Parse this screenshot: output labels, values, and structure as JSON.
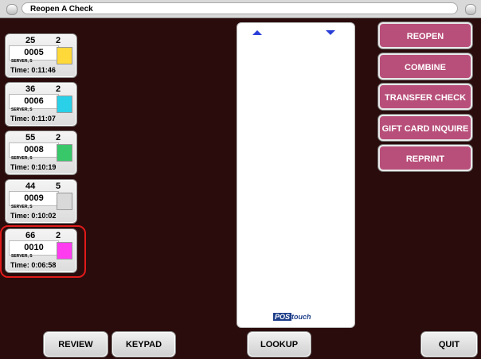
{
  "window": {
    "title": "Reopen A Check"
  },
  "checks": [
    {
      "table": "25",
      "guests": "2",
      "number": "0005",
      "server": "SERVER, S",
      "time": "Time:  0:11:46",
      "color": "#ffd83a"
    },
    {
      "table": "36",
      "guests": "2",
      "number": "0006",
      "server": "SERVER, S",
      "time": "Time:  0:11:07",
      "color": "#2ad0e8"
    },
    {
      "table": "55",
      "guests": "2",
      "number": "0008",
      "server": "SERVER, S",
      "time": "Time:  0:10:19",
      "color": "#38c86a"
    },
    {
      "table": "44",
      "guests": "5",
      "number": "0009",
      "server": "SERVER, S",
      "time": "Time:  0:10:02",
      "color": "#d9d9d9"
    },
    {
      "table": "66",
      "guests": "2",
      "number": "0010",
      "server": "SERVER, S",
      "time": "Time:  0:06:58",
      "color": "#ff3cf0"
    }
  ],
  "selected_check_index": 4,
  "panel": {
    "logo_pos": "POS",
    "logo_touch": "touch"
  },
  "actions": [
    "REOPEN",
    "COMBINE",
    "TRANSFER CHECK",
    "GIFT CARD INQUIRE",
    "REPRINT"
  ],
  "bottom": {
    "review": "REVIEW",
    "keypad": "KEYPAD",
    "lookup": "LOOKUP",
    "quit": "QUIT"
  }
}
